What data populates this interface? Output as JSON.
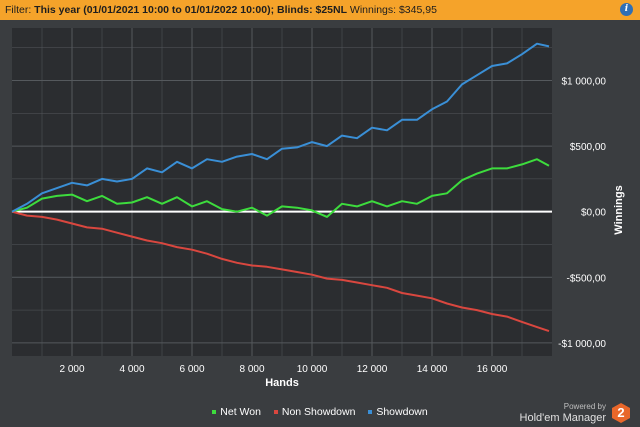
{
  "filter": {
    "prefix": "Filter: ",
    "description": "This year (01/01/2021 10:00 to 01/01/2022 10:00); Blinds: $25NL",
    "winnings_text": " Winnings: $345,95",
    "info_icon": "info-icon"
  },
  "branding": {
    "powered_by": "Powered by",
    "product": "Hold'em Manager",
    "logo_text": "2"
  },
  "colors": {
    "background": "#3a3d40",
    "plot_background": "#2b2d30",
    "grid": "#55595d",
    "net_won": "#3ddc3d",
    "non_showdown": "#d9473f",
    "showdown": "#3a8fd6",
    "header": "#f5a32a"
  },
  "chart_data": {
    "type": "line",
    "xlabel": "Hands",
    "ylabel": "Winnings",
    "xlim": [
      0,
      18000
    ],
    "ylim": [
      -1100,
      1400
    ],
    "x_ticks": [
      2000,
      4000,
      6000,
      8000,
      10000,
      12000,
      14000,
      16000
    ],
    "x_tick_labels": [
      "2 000",
      "4 000",
      "6 000",
      "8 000",
      "10 000",
      "12 000",
      "14 000",
      "16 000"
    ],
    "y_ticks": [
      1000,
      500,
      0,
      -500,
      -1000
    ],
    "y_tick_labels": [
      "$1 000,00",
      "$500,00",
      "$0,00",
      "-$500,00",
      "-$1 000,00"
    ],
    "grid": true,
    "legend_position": "bottom",
    "zero_line": true,
    "x": [
      0,
      500,
      1000,
      1500,
      2000,
      2500,
      3000,
      3500,
      4000,
      4500,
      5000,
      5500,
      6000,
      6500,
      7000,
      7500,
      8000,
      8500,
      9000,
      9500,
      10000,
      10500,
      11000,
      11500,
      12000,
      12500,
      13000,
      13500,
      14000,
      14500,
      15000,
      15500,
      16000,
      16500,
      17000,
      17500,
      17900
    ],
    "series": [
      {
        "name": "Net Won",
        "color": "#3ddc3d",
        "values": [
          0,
          30,
          100,
          120,
          130,
          80,
          120,
          60,
          70,
          110,
          60,
          110,
          40,
          80,
          20,
          0,
          30,
          -30,
          40,
          30,
          10,
          -40,
          60,
          40,
          80,
          40,
          80,
          60,
          120,
          140,
          240,
          290,
          330,
          330,
          360,
          400,
          350
        ]
      },
      {
        "name": "Non Showdown",
        "color": "#d9473f",
        "values": [
          0,
          -30,
          -40,
          -60,
          -90,
          -120,
          -130,
          -160,
          -190,
          -220,
          -240,
          -270,
          -290,
          -320,
          -360,
          -390,
          -410,
          -420,
          -440,
          -460,
          -480,
          -510,
          -520,
          -540,
          -560,
          -580,
          -620,
          -640,
          -660,
          -700,
          -730,
          -750,
          -780,
          -800,
          -840,
          -880,
          -910
        ]
      },
      {
        "name": "Showdown",
        "color": "#3a8fd6",
        "values": [
          0,
          60,
          140,
          180,
          220,
          200,
          250,
          230,
          250,
          330,
          300,
          380,
          330,
          400,
          380,
          420,
          440,
          400,
          480,
          490,
          530,
          500,
          580,
          560,
          640,
          620,
          700,
          700,
          780,
          840,
          970,
          1040,
          1110,
          1130,
          1200,
          1280,
          1260
        ]
      }
    ]
  }
}
